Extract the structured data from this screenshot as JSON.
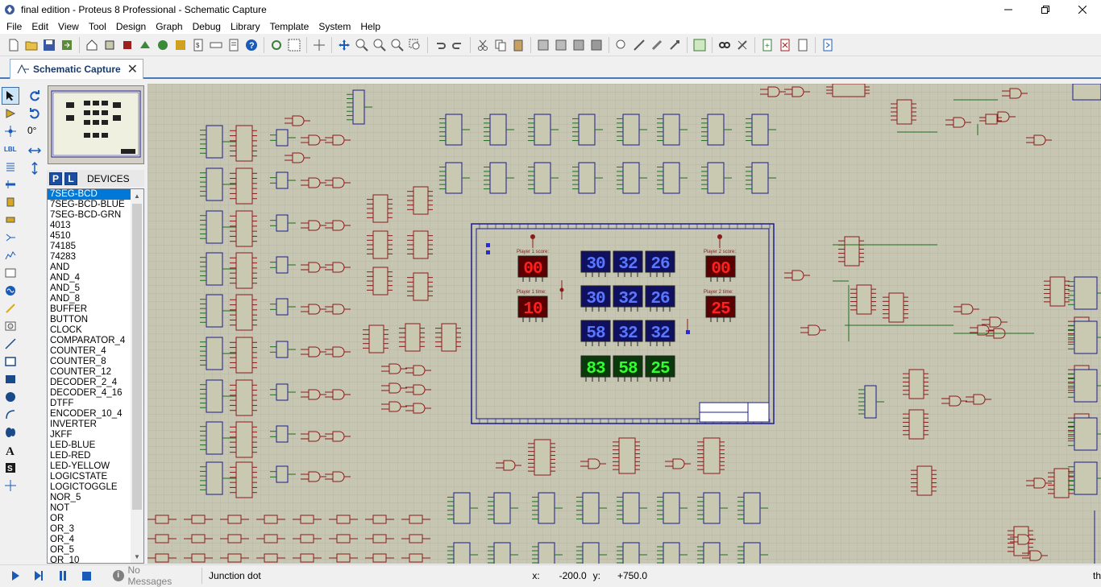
{
  "window": {
    "title": "final edition - Proteus 8 Professional - Schematic Capture"
  },
  "menu": [
    "File",
    "Edit",
    "View",
    "Tool",
    "Design",
    "Graph",
    "Debug",
    "Library",
    "Template",
    "System",
    "Help"
  ],
  "tab": {
    "label": "Schematic Capture"
  },
  "rotation": {
    "value": "0°"
  },
  "devices": {
    "header": "DEVICES",
    "p_label": "P",
    "l_label": "L",
    "selected": "7SEG-BCD",
    "items": [
      "7SEG-BCD",
      "7SEG-BCD-BLUE",
      "7SEG-BCD-GRN",
      "4013",
      "4510",
      "74185",
      "74283",
      "AND",
      "AND_4",
      "AND_5",
      "AND_8",
      "BUFFER",
      "BUTTON",
      "CLOCK",
      "COMPARATOR_4",
      "COUNTER_4",
      "COUNTER_8",
      "COUNTER_12",
      "DECODER_2_4",
      "DECODER_4_16",
      "DTFF",
      "ENCODER_10_4",
      "INVERTER",
      "JKFF",
      "LED-BLUE",
      "LED-RED",
      "LED-YELLOW",
      "LOGICSTATE",
      "LOGICTOGGLE",
      "NOR_5",
      "NOT",
      "OR",
      "OR_3",
      "OR_4",
      "OR_5",
      "OR_10"
    ]
  },
  "schematic": {
    "player1_score_label": "Player 1 score:",
    "player2_score_label": "Player 2 score:",
    "player1_time_label": "Player 1 time:",
    "player2_time_label": "Player 2 time:",
    "player1_score": "00",
    "player2_score": "00",
    "player1_time": "10",
    "player2_time": "25",
    "blue_rows": [
      [
        "30",
        "32",
        "26"
      ],
      [
        "30",
        "32",
        "26"
      ],
      [
        "58",
        "32",
        "32"
      ]
    ],
    "green_row": [
      "83",
      "58",
      "25"
    ]
  },
  "status": {
    "messages": "No Messages",
    "text": "Junction dot",
    "x_label": "x:",
    "x_value": "-200.0",
    "y_label": "y:",
    "y_value": "+750.0",
    "unit": "th"
  },
  "colors": {
    "canvas": "#c6c6b2",
    "grid": "#b2b29c",
    "component": "#c9c9b2",
    "wire": "#1e6e1e",
    "red_part": "#8b1a1a",
    "blue_line": "#1c1c8c"
  }
}
